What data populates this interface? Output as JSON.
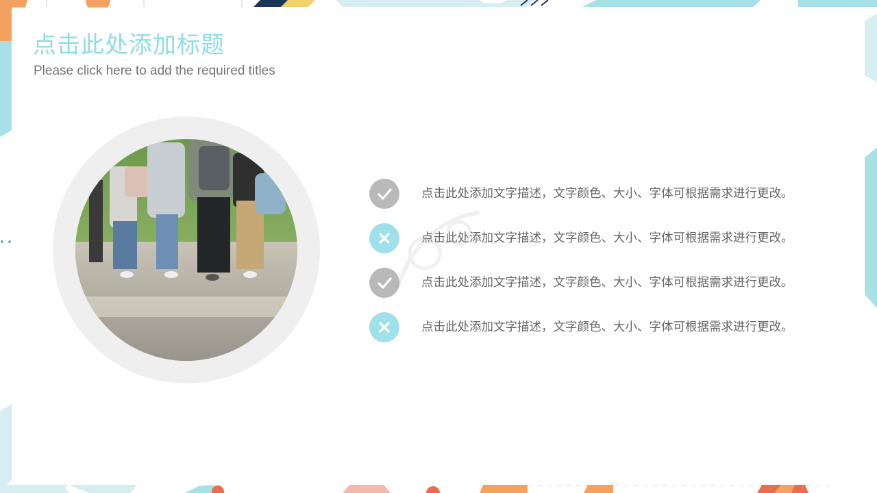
{
  "slide": {
    "title": "点击此处添加标题",
    "subtitle": "Please click here to add the required titles"
  },
  "colors": {
    "title": "#8fdce6",
    "subtitle": "#757575",
    "check_marker": "#b9b9b9",
    "cross_marker": "#9fe0ea",
    "ring": "#efefef",
    "text": "#666666"
  },
  "list": {
    "items": [
      {
        "icon": "check-icon",
        "text": "点击此处添加文字描述，文字颜色、大小、字体可根据需求进行更改。"
      },
      {
        "icon": "cross-icon",
        "text": "点击此处添加文字描述，文字颜色、大小、字体可根据需求进行更改。"
      },
      {
        "icon": "check-icon",
        "text": "点击此处添加文字描述，文字颜色、大小、字体可根据需求进行更改。"
      },
      {
        "icon": "cross-icon",
        "text": "点击此处添加文字描述，文字颜色、大小、字体可根据需求进行更改。"
      }
    ]
  },
  "photo": {
    "subject": "students-walking-photo"
  }
}
